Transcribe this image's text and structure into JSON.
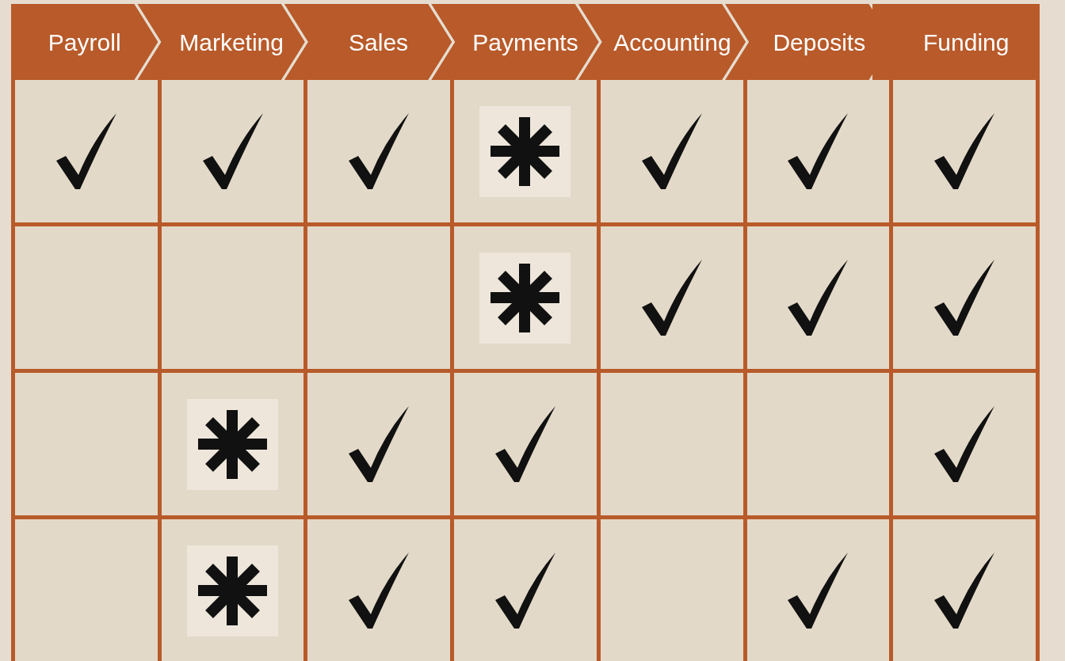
{
  "columns": [
    "Payroll",
    "Marketing",
    "Sales",
    "Payments",
    "Accounting",
    "Deposits",
    "Funding"
  ],
  "rows": [
    {
      "cells": [
        {
          "kind": "check"
        },
        {
          "kind": "check"
        },
        {
          "kind": "check"
        },
        {
          "kind": "asterisk"
        },
        {
          "kind": "check"
        },
        {
          "kind": "check"
        },
        {
          "kind": "check"
        }
      ]
    },
    {
      "cells": [
        {
          "kind": "empty"
        },
        {
          "kind": "empty"
        },
        {
          "kind": "empty"
        },
        {
          "kind": "asterisk"
        },
        {
          "kind": "check"
        },
        {
          "kind": "check"
        },
        {
          "kind": "check"
        }
      ]
    },
    {
      "cells": [
        {
          "kind": "empty"
        },
        {
          "kind": "asterisk"
        },
        {
          "kind": "check"
        },
        {
          "kind": "check"
        },
        {
          "kind": "empty"
        },
        {
          "kind": "empty"
        },
        {
          "kind": "check"
        }
      ]
    },
    {
      "cells": [
        {
          "kind": "empty"
        },
        {
          "kind": "asterisk"
        },
        {
          "kind": "check"
        },
        {
          "kind": "check"
        },
        {
          "kind": "empty"
        },
        {
          "kind": "check"
        },
        {
          "kind": "check"
        }
      ]
    }
  ]
}
